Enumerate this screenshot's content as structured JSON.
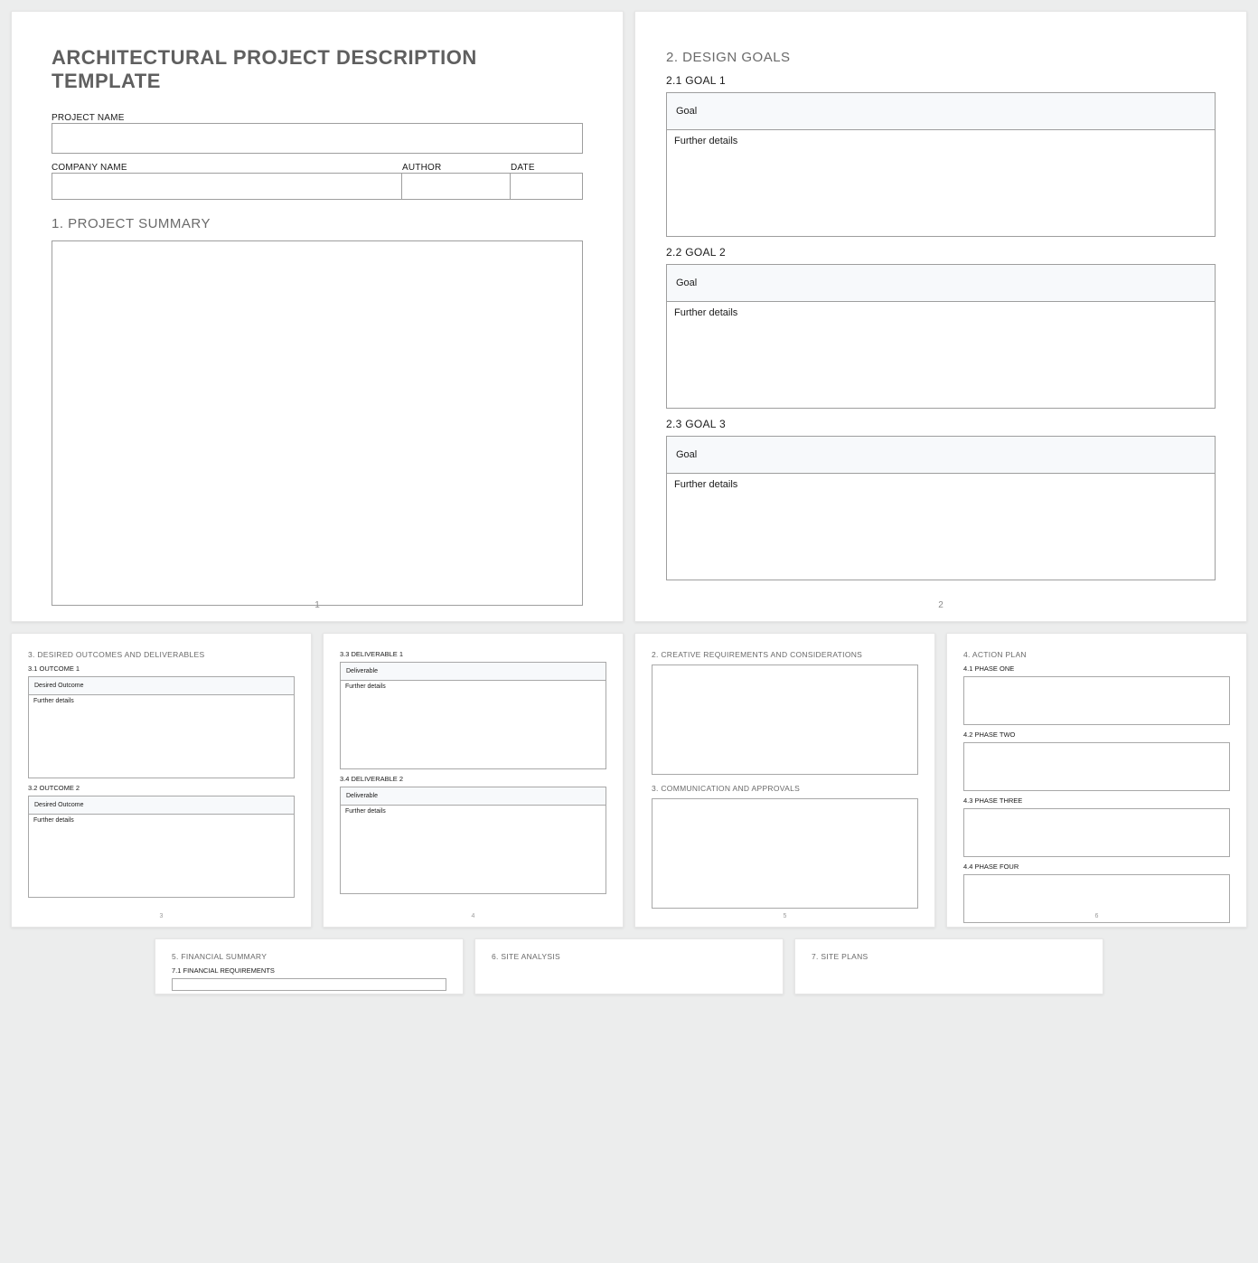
{
  "page1": {
    "title": "ARCHITECTURAL PROJECT DESCRIPTION TEMPLATE",
    "project_name_label": "PROJECT NAME",
    "company_name_label": "COMPANY NAME",
    "author_label": "AUTHOR",
    "date_label": "DATE",
    "section1_heading": "1.  PROJECT SUMMARY",
    "page_number": "1"
  },
  "page2": {
    "section_heading": "2.  DESIGN GOALS",
    "goals": [
      {
        "sub": "2.1 GOAL 1",
        "goal_label": "Goal",
        "details_label": "Further details"
      },
      {
        "sub": "2.2 GOAL 2",
        "goal_label": "Goal",
        "details_label": "Further details"
      },
      {
        "sub": "2.3 GOAL 3",
        "goal_label": "Goal",
        "details_label": "Further details"
      }
    ],
    "page_number": "2"
  },
  "page3": {
    "heading": "3.  DESIRED OUTCOMES AND DELIVERABLES",
    "o1_sub": "3.1 OUTCOME 1",
    "o1_label": "Desired Outcome",
    "o1_details": "Further details",
    "o2_sub": "3.2 OUTCOME 2",
    "o2_label": "Desired Outcome",
    "o2_details": "Further details",
    "page_number": "3"
  },
  "page4": {
    "d3_sub": "3.3 DELIVERABLE 1",
    "d3_label": "Deliverable",
    "d3_details": "Further details",
    "d4_sub": "3.4 DELIVERABLE 2",
    "d4_label": "Deliverable",
    "d4_details": "Further details",
    "page_number": "4"
  },
  "page5": {
    "heading1": "2.  CREATIVE REQUIREMENTS AND CONSIDERATIONS",
    "heading2": "3.  COMMUNICATION AND APPROVALS",
    "page_number": "5"
  },
  "page6": {
    "heading": "4.  ACTION PLAN",
    "p1": "4.1 PHASE ONE",
    "p2": "4.2 PHASE TWO",
    "p3": "4.3 PHASE THREE",
    "p4": "4.4 PHASE FOUR",
    "page_number": "6"
  },
  "page7": {
    "heading": "5.  FINANCIAL SUMMARY",
    "sub": "7.1 FINANCIAL REQUIREMENTS"
  },
  "page8": {
    "heading": "6.  SITE ANALYSIS"
  },
  "page9": {
    "heading": "7.  SITE PLANS"
  }
}
